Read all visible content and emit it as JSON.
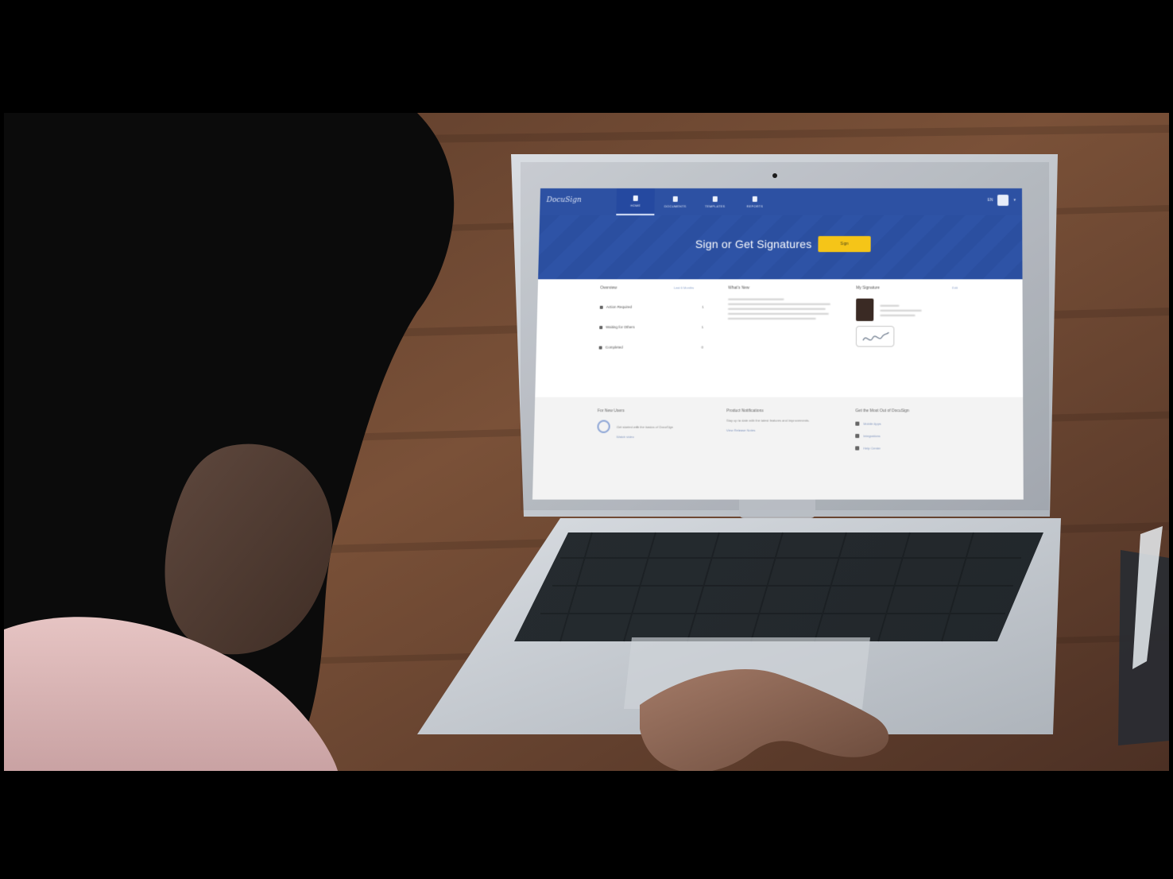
{
  "screen": {
    "brand": "DocuSign",
    "nav_tabs": [
      "HOME",
      "DOCUMENTS",
      "TEMPLATES",
      "REPORTS"
    ],
    "lang": "EN",
    "hero": {
      "title": "Sign or Get Signatures",
      "button": "Sign"
    },
    "cards": {
      "overview_title": "Overview",
      "overview_link": "Last 6 Months",
      "overview_rows": [
        {
          "label": "Action Required",
          "count": "1"
        },
        {
          "label": "Waiting for Others",
          "count": "1"
        },
        {
          "label": "Completed",
          "count": "0"
        }
      ],
      "whats_new_title": "What's New",
      "signature_title": "My Signature",
      "signature_edit": "Edit"
    },
    "footer": {
      "col1_title": "For New Users",
      "col1_text": "Get started with the basics of DocuSign",
      "col1_link": "Watch video",
      "col2_title": "Product Notifications",
      "col2_text": "Stay up to date with the latest features and improvements.",
      "col2_link": "View Release Notes",
      "col3_title": "Get the Most Out of DocuSign",
      "col3_items": [
        "Mobile Apps",
        "Integrations",
        "Help Center"
      ]
    }
  }
}
